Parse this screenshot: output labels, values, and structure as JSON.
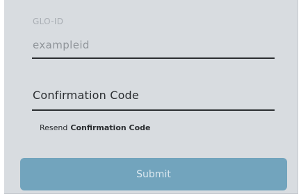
{
  "form": {
    "id_label": "GLO-ID",
    "id_value": "exampleid",
    "code_placeholder": "Confirmation Code",
    "resend_prefix": "Resend",
    "resend_link": "Confirmation Code",
    "submit_label": "Submit"
  },
  "colors": {
    "panel_bg": "#d8dce0",
    "submit_bg": "#72a4bd",
    "underline": "#2a2d30"
  }
}
